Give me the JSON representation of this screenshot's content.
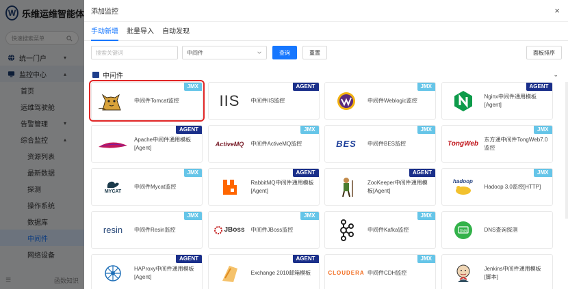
{
  "app": {
    "logo_letter": "W",
    "title": "乐维运维智能体"
  },
  "sidebar": {
    "search_placeholder": "快速搜索菜单",
    "items": [
      {
        "label": "统一门户",
        "level": 0,
        "icon": "globe-icon"
      },
      {
        "label": "监控中心",
        "level": 0,
        "icon": "monitor-icon"
      },
      {
        "label": "首页",
        "level": 1
      },
      {
        "label": "运维驾驶舱",
        "level": 1
      },
      {
        "label": "告警管理",
        "level": 1
      },
      {
        "label": "综合监控",
        "level": 1
      },
      {
        "label": "资源列表",
        "level": 2
      },
      {
        "label": "最新数据",
        "level": 2
      },
      {
        "label": "探测",
        "level": 2
      },
      {
        "label": "操作系统",
        "level": 2
      },
      {
        "label": "数据库",
        "level": 2
      },
      {
        "label": "中间件",
        "level": 2
      },
      {
        "label": "网络设备",
        "level": 2
      }
    ],
    "footer_label": "函数知识"
  },
  "drawer": {
    "title": "添加监控",
    "close_glyph": "×",
    "tabs": [
      "手动新增",
      "批量导入",
      "自动发现"
    ],
    "keyword_placeholder": "搜索关键词",
    "select_value": "中间件",
    "query_label": "查询",
    "reset_label": "重置",
    "sort_label": "面板排序",
    "section_label": "中间件",
    "collapse_glyph": "⌄"
  },
  "cards": [
    {
      "name": "中间件Tomcat监控",
      "badge": "JMX",
      "logo": "tomcat-icon"
    },
    {
      "name": "中间件IIS监控",
      "badge": "AGENT",
      "logo": "iis-icon",
      "logo_text": "IIS"
    },
    {
      "name": "中间件Weblogic监控",
      "badge": "JMX",
      "logo": "weblogic-icon"
    },
    {
      "name": "Nginx中间件通用模板[Agent]",
      "badge": "AGENT",
      "logo": "nginx-icon"
    },
    {
      "name": "Apache中间件通用模板[Agent]",
      "badge": "AGENT",
      "logo": "apache-feather-icon"
    },
    {
      "name": "中间件ActiveMQ监控",
      "badge": "JMX",
      "logo": "activemq-icon",
      "logo_text": "ActiveMQ"
    },
    {
      "name": "中间件BES监控",
      "badge": "JMX",
      "logo": "bes-icon",
      "logo_text": "BES"
    },
    {
      "name": "东方通中间件TongWeb7.0监控",
      "badge": "JMX",
      "logo": "tongweb-icon",
      "logo_text": "TongWeb"
    },
    {
      "name": "中间件Mycat监控",
      "badge": "JMX",
      "logo": "mycat-icon",
      "logo_text": "MYCAT"
    },
    {
      "name": "RabbitMQ中间件通用模板[Agent]",
      "badge": "AGENT",
      "logo": "rabbitmq-icon"
    },
    {
      "name": "ZooKeeper中间件通用模板[Agent]",
      "badge": "AGENT",
      "logo": "zookeeper-icon"
    },
    {
      "name": "Hadoop 3.0监控[HTTP]",
      "badge": "JMX",
      "logo": "hadoop-icon",
      "logo_text": "hadoop"
    },
    {
      "name": "中间件Resin监控",
      "badge": "JMX",
      "logo": "resin-icon",
      "logo_text": "resin"
    },
    {
      "name": "中间件JBoss监控",
      "badge": "JMX",
      "logo": "jboss-icon",
      "logo_text": "JBoss"
    },
    {
      "name": "中间件Kafka监控",
      "badge": "JMX",
      "logo": "kafka-icon"
    },
    {
      "name": "DNS查询探测",
      "badge": "",
      "logo": "dns-icon",
      "logo_text": "DNS"
    },
    {
      "name": "HAProxy中间件通用模板[Agent]",
      "badge": "AGENT",
      "logo": "haproxy-icon"
    },
    {
      "name": "Exchange 2010邮箱模板",
      "badge": "AGENT",
      "logo": "exchange-icon"
    },
    {
      "name": "中间件CDH监控",
      "badge": "JMX",
      "logo": "cloudera-icon",
      "logo_text": "CLOUDERA"
    },
    {
      "name": "Jenkins中间件通用模板[脚本]",
      "badge": "",
      "logo": "jenkins-icon"
    }
  ],
  "colors": {
    "primary": "#1677ff",
    "jmx_badge": "#66c5e8",
    "agent_badge": "#1a2f8a",
    "highlight_border": "#e02424"
  }
}
